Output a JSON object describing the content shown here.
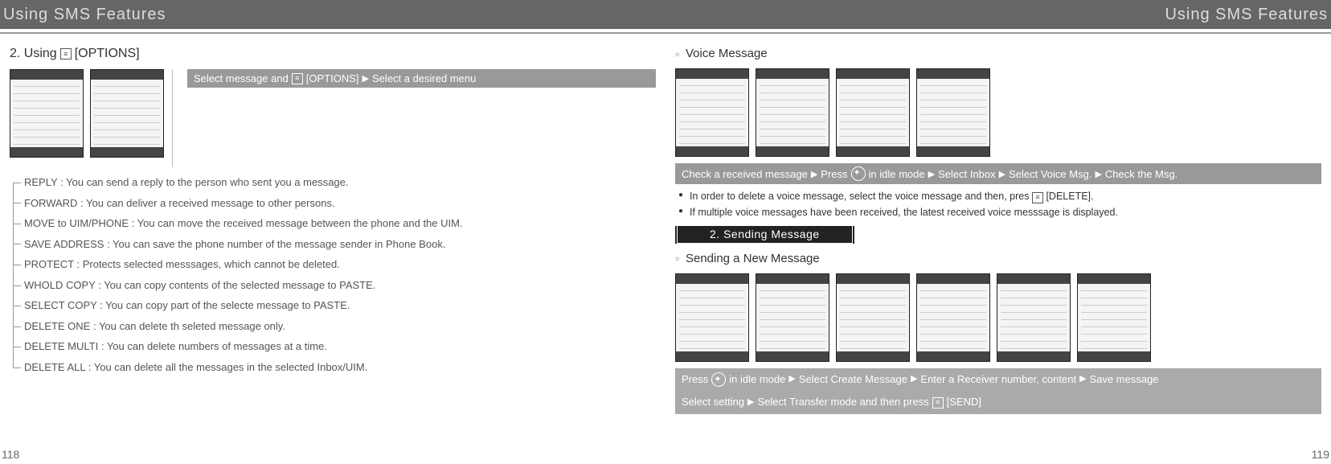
{
  "header": {
    "title_left": "Using SMS Features",
    "title_right": "Using SMS Features"
  },
  "left": {
    "subhead_prefix": "2. Using",
    "subhead_label": "[OPTIONS]",
    "grey_band_a": "Select message and",
    "grey_band_b": "[OPTIONS]",
    "grey_band_c": "Select a desired menu",
    "options": [
      "REPLY : You can send a reply to the person who sent you a message.",
      "FORWARD : You can deliver a received message to other persons.",
      "MOVE to UIM/PHONE : You can move the received message between the phone and the UIM.",
      "SAVE ADDRESS : You can save the phone number of the message sender in Phone Book.",
      "PROTECT : Protects selected messsages, which cannot be deleted.",
      "WHOLD COPY : You can copy contents of the selected message to PASTE.",
      "SELECT COPY : You can copy part of the selecte message to PASTE.",
      "DELETE ONE : You can delete th seleted message only.",
      "DELETE MULTI : You can delete numbers of messages at a time.",
      "DELETE ALL : You can delete all the messages in the selected Inbox/UIM."
    ],
    "page_number": "118"
  },
  "right": {
    "voice_head": "Voice Message",
    "check_a": "Check a received message",
    "check_b": "Press",
    "check_c": "in idle mode",
    "check_d": "Select Inbox",
    "check_e": "Select Voice Msg.",
    "check_f": "Check the Msg.",
    "bullet1_a": "In order to delete a voice message, select the voice message and then, pres",
    "bullet1_b": "[DELETE].",
    "bullet2": "If multiple voice messages have been received, the latest received voice messsage is displayed.",
    "section2_label": "2. Sending Message",
    "sending_head": "Sending a New Message",
    "press_a": "Press",
    "press_b": "in idle mode",
    "press_c": "Select Create Message",
    "press_d": "Enter a Receiver number, content",
    "press_e": "Save message",
    "press_f": "Select setting",
    "press_g": "Select Transfer mode and then press",
    "press_h": "[SEND]",
    "page_number": "119"
  }
}
